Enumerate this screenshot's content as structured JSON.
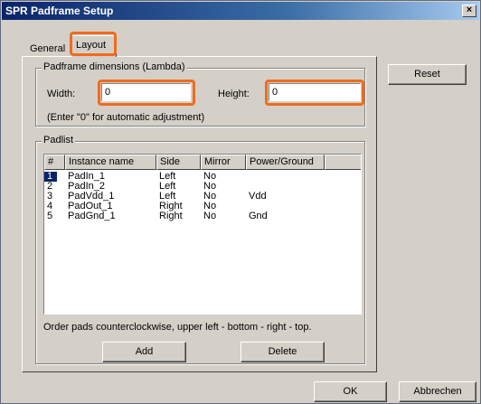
{
  "window": {
    "title": "SPR Padframe Setup",
    "close_glyph": "×"
  },
  "tabs": [
    {
      "label": "General",
      "active": false
    },
    {
      "label": "Layout",
      "active": true
    }
  ],
  "padframe": {
    "legend": "Padframe dimensions (Lambda)",
    "width_label": "Width:",
    "width_value": "0",
    "height_label": "Height:",
    "height_value": "0",
    "note": "(Enter \"0\" for automatic adjustment)"
  },
  "padlist": {
    "legend": "Padlist",
    "columns": [
      "#",
      "Instance name",
      "Side",
      "Mirror",
      "Power/Ground"
    ],
    "rows": [
      [
        "1",
        "PadIn_1",
        "Left",
        "No",
        ""
      ],
      [
        "2",
        "PadIn_2",
        "Left",
        "No",
        ""
      ],
      [
        "3",
        "PadVdd_1",
        "Left",
        "No",
        "Vdd"
      ],
      [
        "4",
        "PadOut_1",
        "Right",
        "No",
        ""
      ],
      [
        "5",
        "PadGnd_1",
        "Right",
        "No",
        "Gnd"
      ]
    ],
    "selected_row": 0,
    "hint": "Order pads counterclockwise, upper left - bottom - right - top.",
    "add_label": "Add",
    "delete_label": "Delete"
  },
  "buttons": {
    "reset": "Reset",
    "ok": "OK",
    "cancel": "Abbrechen"
  },
  "colors": {
    "highlight": "#f26b1d",
    "title_bar": "#0a246a",
    "dialog_bg": "#d4d0c8"
  }
}
